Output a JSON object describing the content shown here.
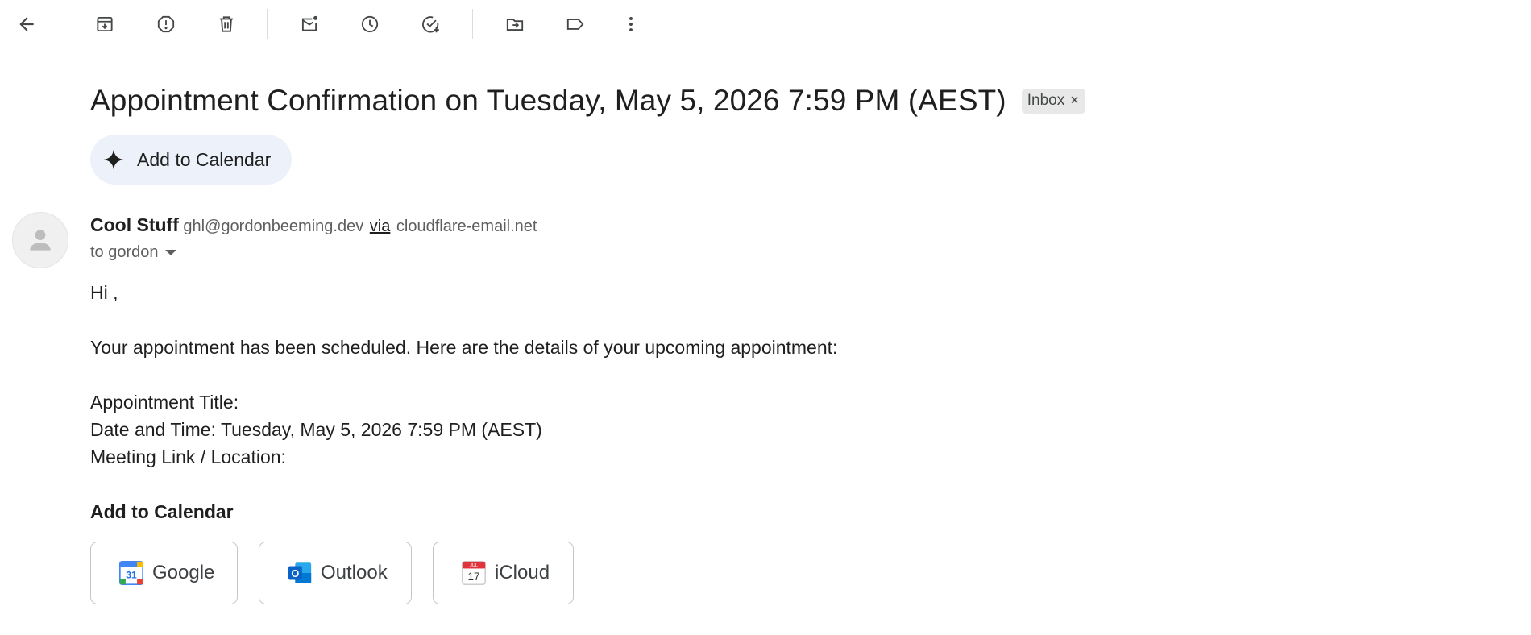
{
  "toolbar": {
    "icons": [
      "back-arrow-icon",
      "archive-icon",
      "report-spam-icon",
      "delete-icon",
      "mark-unread-icon",
      "snooze-icon",
      "add-to-tasks-icon",
      "move-to-icon",
      "label-icon",
      "more-vert-icon"
    ]
  },
  "email": {
    "subject": "Appointment Confirmation on Tuesday, May 5, 2026 7:59 PM (AEST)",
    "label_chip": "Inbox",
    "label_chip_remove": "×",
    "smart_action": "Add to Calendar",
    "sender": {
      "name": "Cool Stuff",
      "email": "ghl@gordonbeeming.dev",
      "via": "via",
      "via_domain": "cloudflare-email.net"
    },
    "recipient": "to gordon",
    "body": {
      "greeting": "Hi ,",
      "intro": "Your appointment has been scheduled. Here are the details of your upcoming appointment:",
      "title_line": "Appointment Title:",
      "datetime_line": "Date and Time: Tuesday, May 5, 2026 7:59 PM (AEST)",
      "location_line": "Meeting Link / Location:",
      "calendar_heading": "Add to Calendar"
    },
    "calendar_buttons": [
      {
        "label": "Google",
        "icon": "google-calendar-icon",
        "icon_text": "31"
      },
      {
        "label": "Outlook",
        "icon": "outlook-icon",
        "icon_text": "O"
      },
      {
        "label": "iCloud",
        "icon": "icloud-calendar-icon",
        "icon_text": "17",
        "icon_top_text": "JUL"
      }
    ]
  },
  "colors": {
    "chip_bg": "#e8e8e8",
    "smart_chip_bg": "#edf1fa",
    "google_blue": "#4285f4",
    "outlook_blue": "#0a64c8",
    "icloud_red": "#e0333c"
  }
}
